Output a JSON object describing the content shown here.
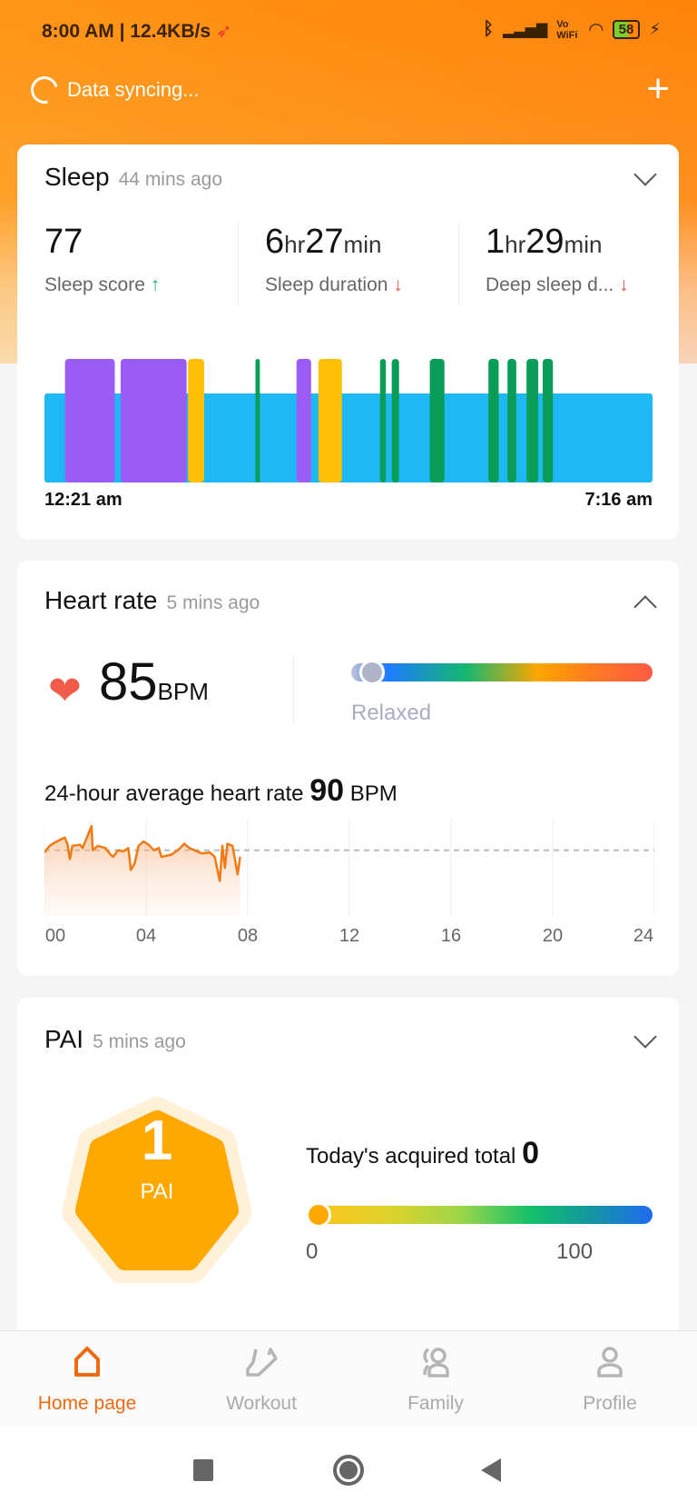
{
  "status_bar": {
    "time": "8:00 AM",
    "speed": "12.4KB/s",
    "battery": "58",
    "vowifi": "Vo WiFi"
  },
  "header": {
    "sync_text": "Data syncing...",
    "add_icon": "plus-icon"
  },
  "colors": {
    "accent": "#ee6a10",
    "header": "#ff8a0c",
    "sleep_light": "#1eb8f5",
    "sleep_purple": "#9b5cf6",
    "sleep_yellow": "#ffc107",
    "sleep_green": "#0a9d58",
    "hr_line": "#f07a14",
    "pai": "#ffa800"
  },
  "sleep": {
    "title": "Sleep",
    "updated": "44 mins ago",
    "expanded": false,
    "stats": [
      {
        "value": "77",
        "label": "Sleep score",
        "trend": "up"
      },
      {
        "h": "6",
        "h_unit": "hr",
        "m": "27",
        "m_unit": "min",
        "label": "Sleep duration",
        "trend": "down"
      },
      {
        "h": "1",
        "h_unit": "hr",
        "m": "29",
        "m_unit": "min",
        "label": "Deep sleep d...",
        "trend": "down"
      }
    ],
    "start_label": "12:21 am",
    "end_label": "7:16 am",
    "chart_data": {
      "type": "timeline",
      "start": "00:21",
      "end": "07:16",
      "base_color": "#1eb8f5",
      "segments": [
        {
          "start": "00:35",
          "end": "01:09",
          "color": "#9b5cf6"
        },
        {
          "start": "01:13",
          "end": "01:58",
          "color": "#9b5cf6"
        },
        {
          "start": "01:59",
          "end": "02:10",
          "color": "#ffc107"
        },
        {
          "start": "02:45",
          "end": "02:48",
          "color": "#0a9d58"
        },
        {
          "start": "03:13",
          "end": "03:23",
          "color": "#9b5cf6"
        },
        {
          "start": "03:28",
          "end": "03:44",
          "color": "#ffc107"
        },
        {
          "start": "04:10",
          "end": "04:14",
          "color": "#0a9d58"
        },
        {
          "start": "04:18",
          "end": "04:23",
          "color": "#0a9d58"
        },
        {
          "start": "04:44",
          "end": "04:54",
          "color": "#0a9d58"
        },
        {
          "start": "05:24",
          "end": "05:31",
          "color": "#0a9d58"
        },
        {
          "start": "05:37",
          "end": "05:43",
          "color": "#0a9d58"
        },
        {
          "start": "05:50",
          "end": "05:58",
          "color": "#0a9d58"
        },
        {
          "start": "06:01",
          "end": "06:08",
          "color": "#0a9d58"
        }
      ]
    }
  },
  "heart": {
    "title": "Heart rate",
    "updated": "5 mins ago",
    "expanded": true,
    "value": "85",
    "unit": "BPM",
    "zone": "Relaxed",
    "zone_level": 0.07,
    "avg_label": "24-hour average heart rate",
    "avg_value": "90",
    "avg_unit": "BPM",
    "chart_data": {
      "type": "area",
      "xlim": [
        0,
        24
      ],
      "ylim": [
        60,
        104
      ],
      "average": 90,
      "x_ticks": [
        "00",
        "04",
        "08",
        "12",
        "16",
        "20",
        "24"
      ],
      "points": [
        [
          0,
          89
        ],
        [
          0.2,
          92
        ],
        [
          0.4,
          93.5
        ],
        [
          0.8,
          95.8
        ],
        [
          0.9,
          93
        ],
        [
          1.0,
          86
        ],
        [
          1.1,
          92
        ],
        [
          1.4,
          92.5
        ],
        [
          1.5,
          91
        ],
        [
          1.85,
          101
        ],
        [
          1.9,
          90
        ],
        [
          2.1,
          92
        ],
        [
          2.4,
          91
        ],
        [
          2.6,
          88
        ],
        [
          2.7,
          87
        ],
        [
          2.9,
          90
        ],
        [
          3.1,
          89.5
        ],
        [
          3.3,
          91
        ],
        [
          3.4,
          81
        ],
        [
          3.55,
          84
        ],
        [
          3.7,
          92
        ],
        [
          3.9,
          94
        ],
        [
          4.1,
          92.5
        ],
        [
          4.3,
          90
        ],
        [
          4.5,
          91
        ],
        [
          4.6,
          87
        ],
        [
          4.8,
          87.5
        ],
        [
          5.0,
          88
        ],
        [
          5.3,
          90.5
        ],
        [
          5.5,
          93
        ],
        [
          5.7,
          91
        ],
        [
          5.9,
          90
        ],
        [
          6.2,
          88.5
        ],
        [
          6.5,
          89
        ],
        [
          6.7,
          87
        ],
        [
          6.9,
          76
        ],
        [
          7.0,
          92
        ],
        [
          7.1,
          82
        ],
        [
          7.2,
          93
        ],
        [
          7.4,
          92
        ],
        [
          7.6,
          79
        ],
        [
          7.7,
          87
        ]
      ]
    }
  },
  "pai": {
    "title": "PAI",
    "updated": "5 mins ago",
    "expanded": false,
    "value": "1",
    "unit": "PAI",
    "today_label": "Today's acquired total",
    "today_value": "0",
    "scale_min": "0",
    "scale_max": "100",
    "level": 0.0
  },
  "nav": [
    {
      "label": "Home page",
      "icon": "home-icon",
      "active": true
    },
    {
      "label": "Workout",
      "icon": "shoe-icon"
    },
    {
      "label": "Family",
      "icon": "family-icon"
    },
    {
      "label": "Profile",
      "icon": "profile-icon"
    }
  ]
}
